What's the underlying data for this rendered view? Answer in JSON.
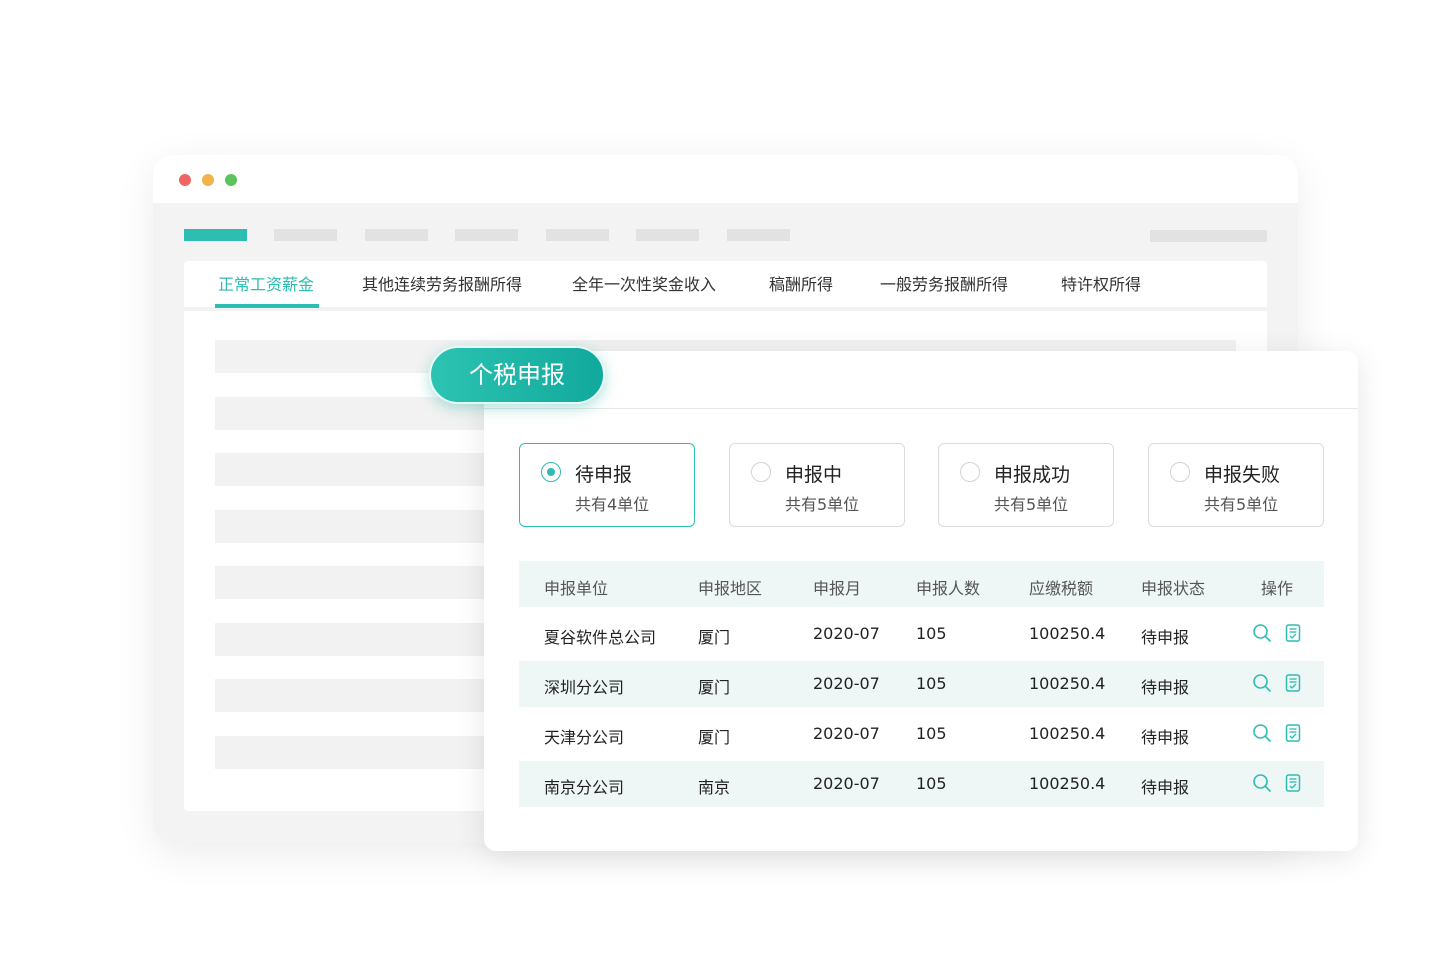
{
  "window": {
    "controls": {
      "close_color": "#ee6565",
      "minimize_color": "#f2b24c",
      "maximize_color": "#5cc45c"
    }
  },
  "tabs": [
    {
      "label": "正常工资薪金",
      "active": true
    },
    {
      "label": "其他连续劳务报酬所得",
      "active": false
    },
    {
      "label": "全年一次性奖金收入",
      "active": false
    },
    {
      "label": "稿酬所得",
      "active": false
    },
    {
      "label": "一般劳务报酬所得",
      "active": false
    },
    {
      "label": "特许权所得",
      "active": false
    }
  ],
  "card": {
    "title": "个税申报",
    "status_filters": [
      {
        "label": "待申报",
        "count_text": "共有4单位",
        "selected": true
      },
      {
        "label": "申报中",
        "count_text": "共有5单位",
        "selected": false
      },
      {
        "label": "申报成功",
        "count_text": "共有5单位",
        "selected": false
      },
      {
        "label": "申报失败",
        "count_text": "共有5单位",
        "selected": false
      }
    ],
    "table": {
      "columns": [
        "申报单位",
        "申报地区",
        "申报月",
        "申报人数",
        "应缴税额",
        "申报状态",
        "操作"
      ],
      "rows": [
        {
          "unit": "夏谷软件总公司",
          "region": "厦门",
          "month": "2020-07",
          "people": "105",
          "tax": "100250.4",
          "status": "待申报"
        },
        {
          "unit": "深圳分公司",
          "region": "厦门",
          "month": "2020-07",
          "people": "105",
          "tax": "100250.4",
          "status": "待申报"
        },
        {
          "unit": "天津分公司",
          "region": "厦门",
          "month": "2020-07",
          "people": "105",
          "tax": "100250.4",
          "status": "待申报"
        },
        {
          "unit": "南京分公司",
          "region": "南京",
          "month": "2020-07",
          "people": "105",
          "tax": "100250.4",
          "status": "待申报"
        }
      ],
      "row_actions": [
        "search-icon",
        "document-icon"
      ]
    }
  },
  "colors": {
    "accent": "#2dbdb1",
    "stripe": "#eef7f6",
    "placeholder": "#f2f2f2"
  }
}
